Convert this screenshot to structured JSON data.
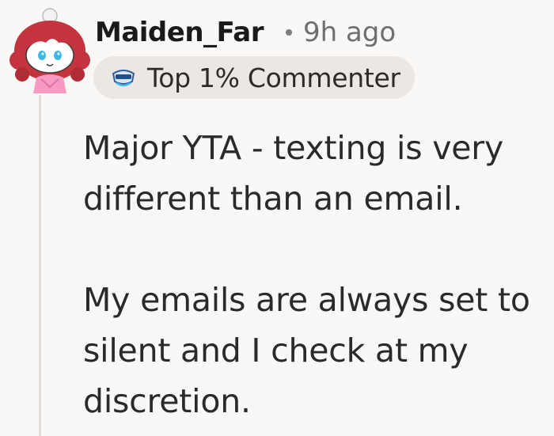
{
  "comment": {
    "username": "Maiden_Far",
    "timestamp": "9h ago",
    "badge": {
      "label": "Top 1% Commenter",
      "icon": "commenter-badge-icon"
    },
    "avatar": "snoo-avatar",
    "paragraphs": [
      "Major YTA - texting is very different than an email.",
      "My emails are always set to silent and I check at my discretion."
    ]
  },
  "colors": {
    "background": "#faf8f6",
    "thread_line": "#e3dedb",
    "badge_bg": "#ece7e3",
    "text": "#2a2a2a",
    "muted": "#6f6f6f"
  }
}
